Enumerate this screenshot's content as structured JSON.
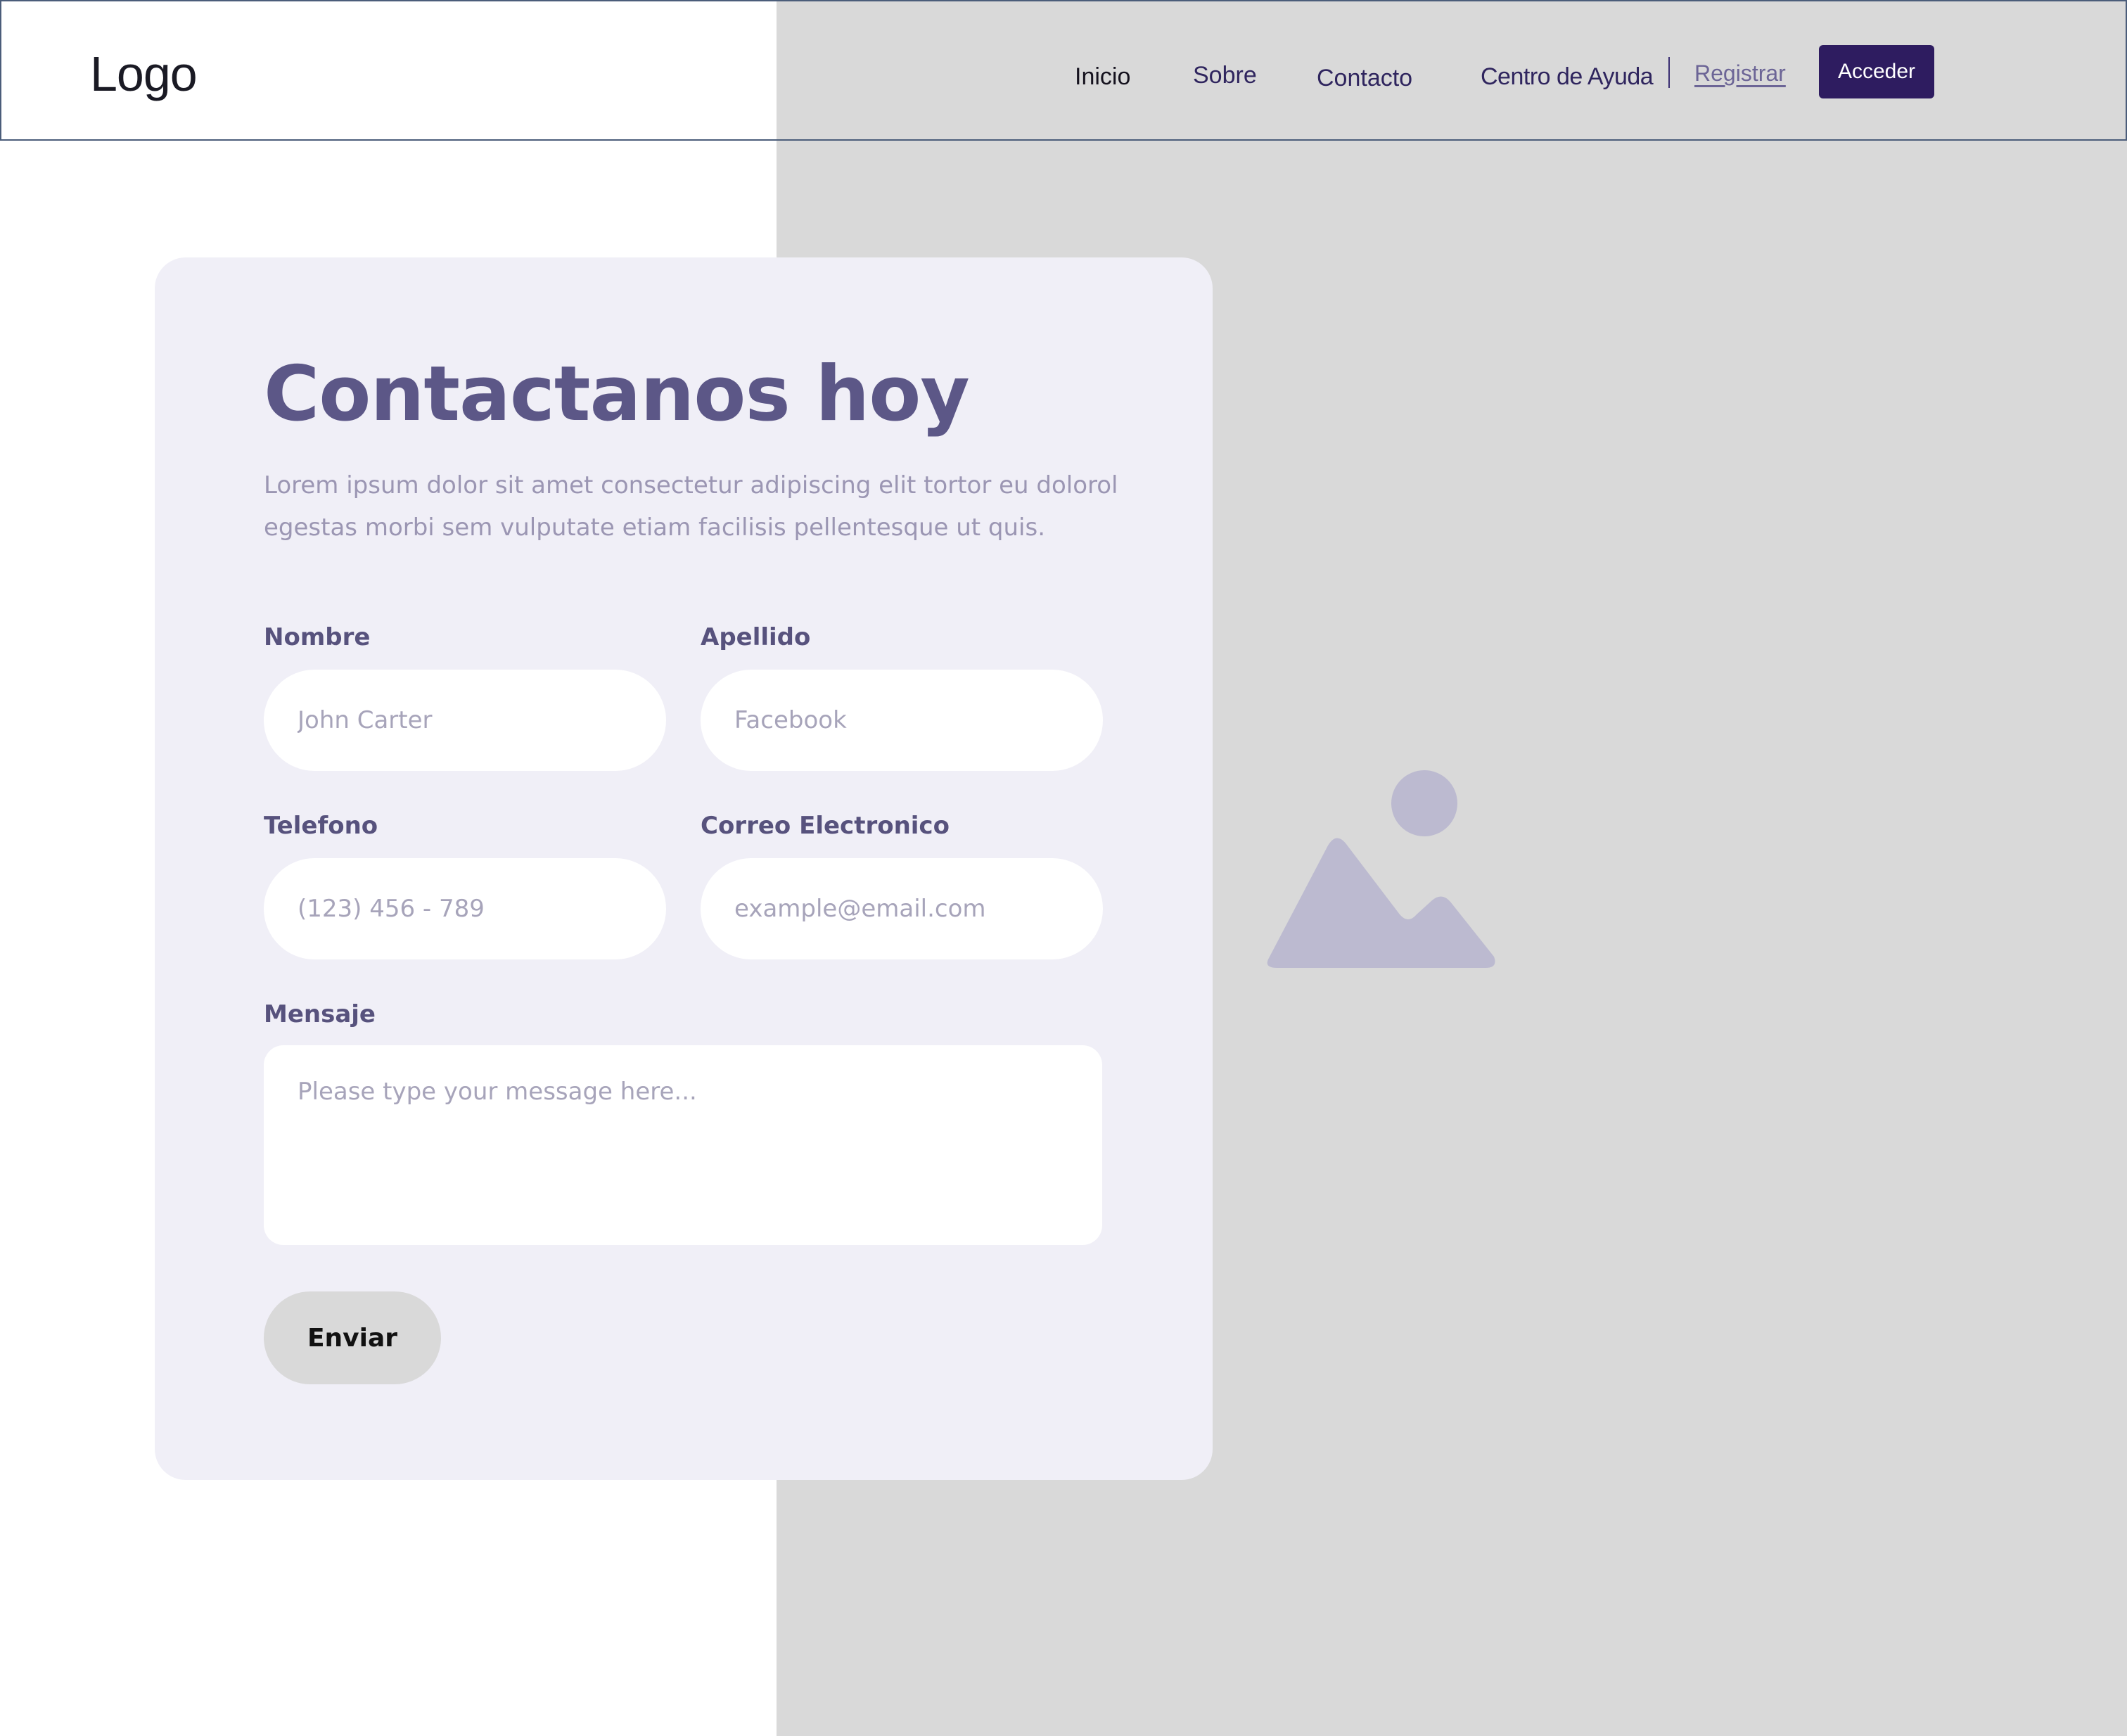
{
  "header": {
    "logo": "Logo",
    "nav": {
      "inicio": "Inicio",
      "sobre": "Sobre",
      "contacto": "Contacto",
      "ayuda": "Centro de Ayuda"
    },
    "register_label": "Registrar",
    "login_label": "Acceder"
  },
  "form": {
    "title": "Contactanos hoy",
    "description": "Lorem ipsum dolor sit amet consectetur adipiscing elit tortor eu dolorol egestas morbi sem vulputate etiam facilisis pellentesque ut quis.",
    "first_name": {
      "label": "Nombre",
      "placeholder": "John Carter",
      "value": ""
    },
    "last_name": {
      "label": "Apellido",
      "placeholder": "Facebook",
      "value": ""
    },
    "phone": {
      "label": "Telefono",
      "placeholder": "(123) 456 - 789",
      "value": ""
    },
    "email": {
      "label": "Correo Electronico",
      "placeholder": "example@email.com",
      "value": ""
    },
    "message": {
      "label": "Mensaje",
      "placeholder": "Please type your message here...",
      "value": ""
    },
    "submit_label": "Enviar"
  },
  "media": {
    "placeholder_icon": "image-placeholder-icon"
  },
  "colors": {
    "primary": "#2e1c60",
    "heading": "#5c5787",
    "card_background": "#f0eff7",
    "image_panel": "#d9d9d9",
    "placeholder_icon": "#bcbad0"
  }
}
